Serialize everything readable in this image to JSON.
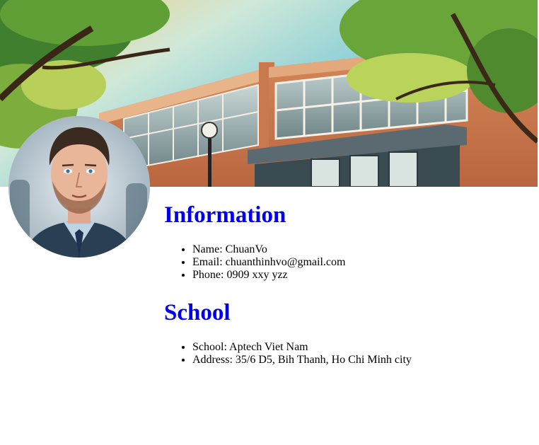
{
  "banner": {
    "image": "school-building-illustration"
  },
  "avatar": {
    "image": "man-portrait"
  },
  "information": {
    "title": "Information",
    "items": [
      "Name: ChuanVo",
      "Email: chuanthinhvo@gmail.com",
      "Phone: 0909 xxy yzz"
    ]
  },
  "school": {
    "title": "School",
    "items": [
      "School: Aptech Viet Nam",
      "Address: 35/6 D5, Bih Thanh, Ho Chi Minh city"
    ]
  },
  "colors": {
    "heading": "#0000ee",
    "text": "#000000"
  }
}
